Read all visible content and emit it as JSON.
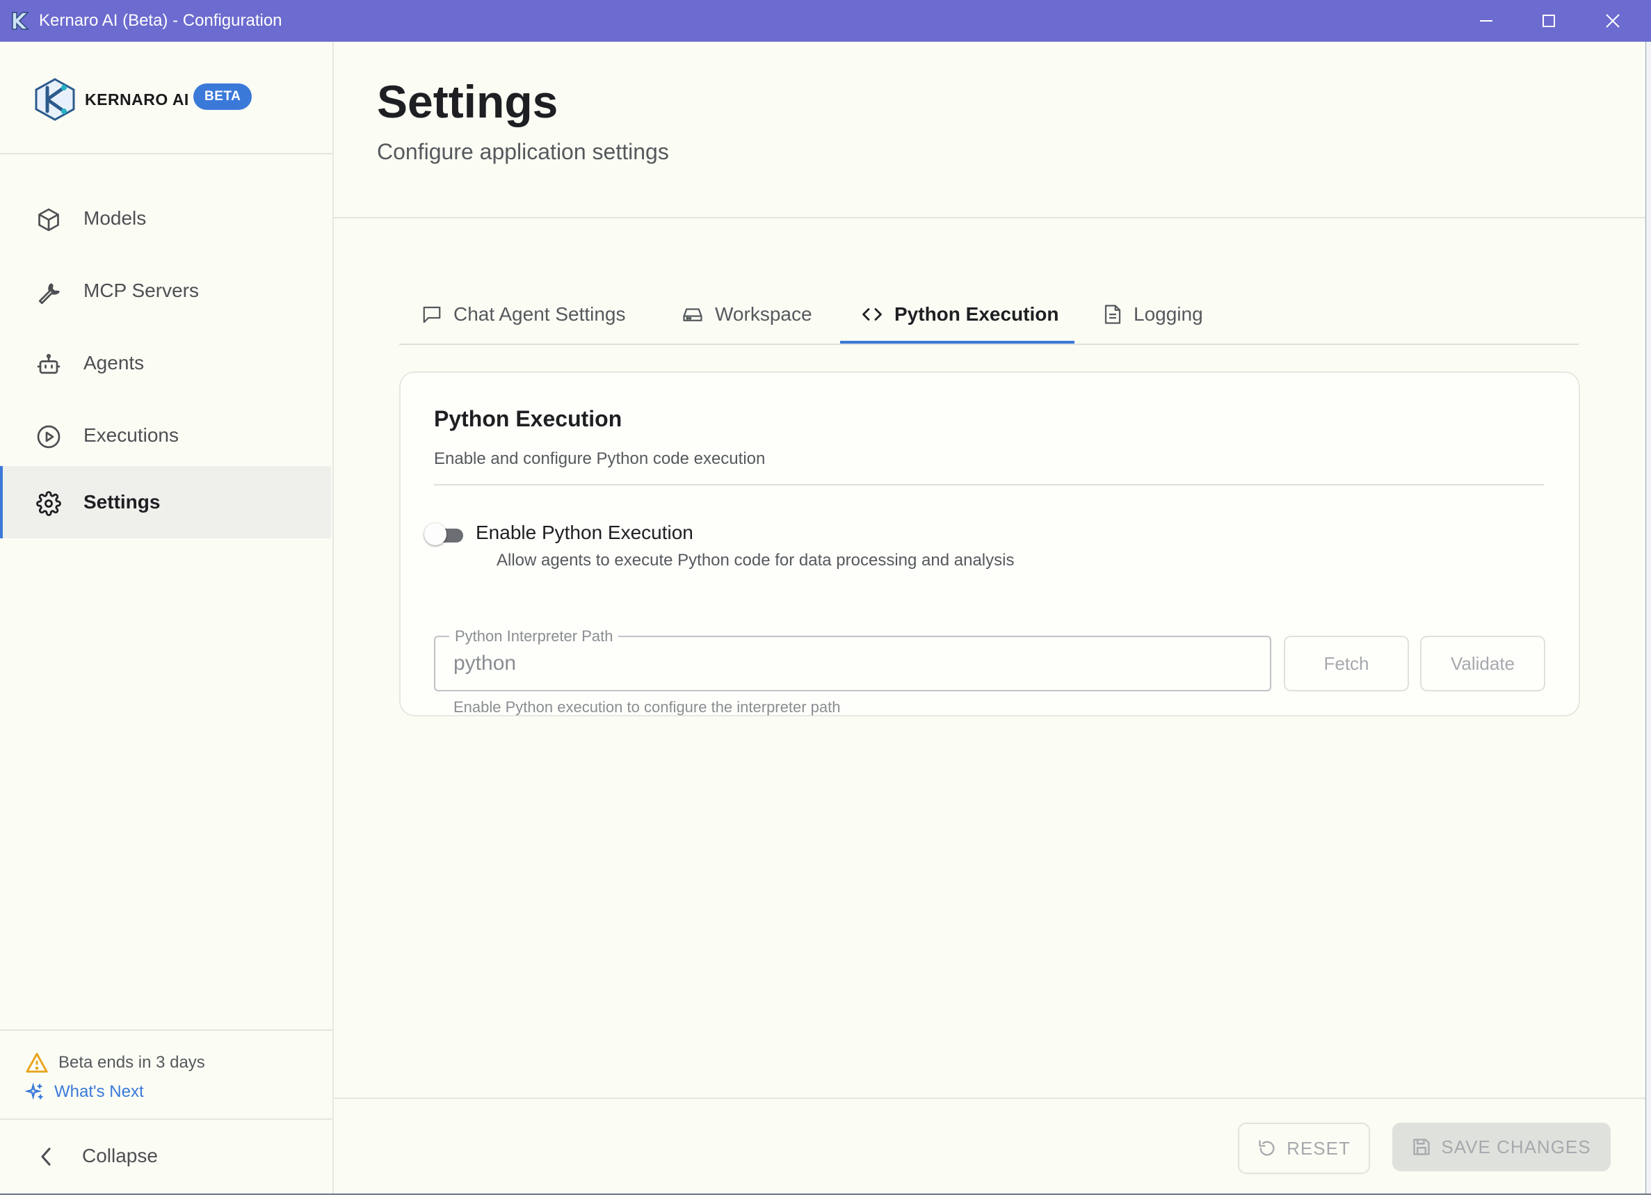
{
  "window": {
    "title": "Kernaro AI (Beta) - Configuration",
    "controls": [
      "minimize-icon",
      "maximize-icon",
      "close-icon"
    ]
  },
  "brand": {
    "name": "KERNARO AI",
    "badge": "BETA",
    "accent": "#3b79d9",
    "titlebar_color": "#6c6bcf"
  },
  "sidebar": {
    "items": [
      {
        "label": "Models",
        "icon": "cube-icon",
        "active": false
      },
      {
        "label": "MCP Servers",
        "icon": "wrench-icon",
        "active": false
      },
      {
        "label": "Agents",
        "icon": "robot-icon",
        "active": false
      },
      {
        "label": "Executions",
        "icon": "play-circle-icon",
        "active": false
      },
      {
        "label": "Settings",
        "icon": "gear-icon",
        "active": true
      }
    ],
    "beta_notice": "Beta ends in 3 days",
    "whats_next": "What's Next",
    "collapse": "Collapse"
  },
  "header": {
    "title": "Settings",
    "subtitle": "Configure application settings"
  },
  "tabs": [
    {
      "label": "Chat Agent Settings",
      "icon": "chat-bubble-icon",
      "active": false
    },
    {
      "label": "Workspace",
      "icon": "drive-icon",
      "active": false
    },
    {
      "label": "Python Execution",
      "icon": "code-icon",
      "active": true
    },
    {
      "label": "Logging",
      "icon": "document-icon",
      "active": false
    }
  ],
  "panel": {
    "title": "Python Execution",
    "description": "Enable and configure Python code execution",
    "toggle": {
      "label": "Enable Python Execution",
      "description": "Allow agents to execute Python code for data processing and analysis",
      "enabled": false
    },
    "interpreter": {
      "label": "Python Interpreter Path",
      "value": "python",
      "helper": "Enable Python execution to configure the interpreter path",
      "fetch_label": "Fetch",
      "validate_label": "Validate"
    }
  },
  "actions": {
    "reset": "RESET",
    "save": "SAVE CHANGES"
  }
}
